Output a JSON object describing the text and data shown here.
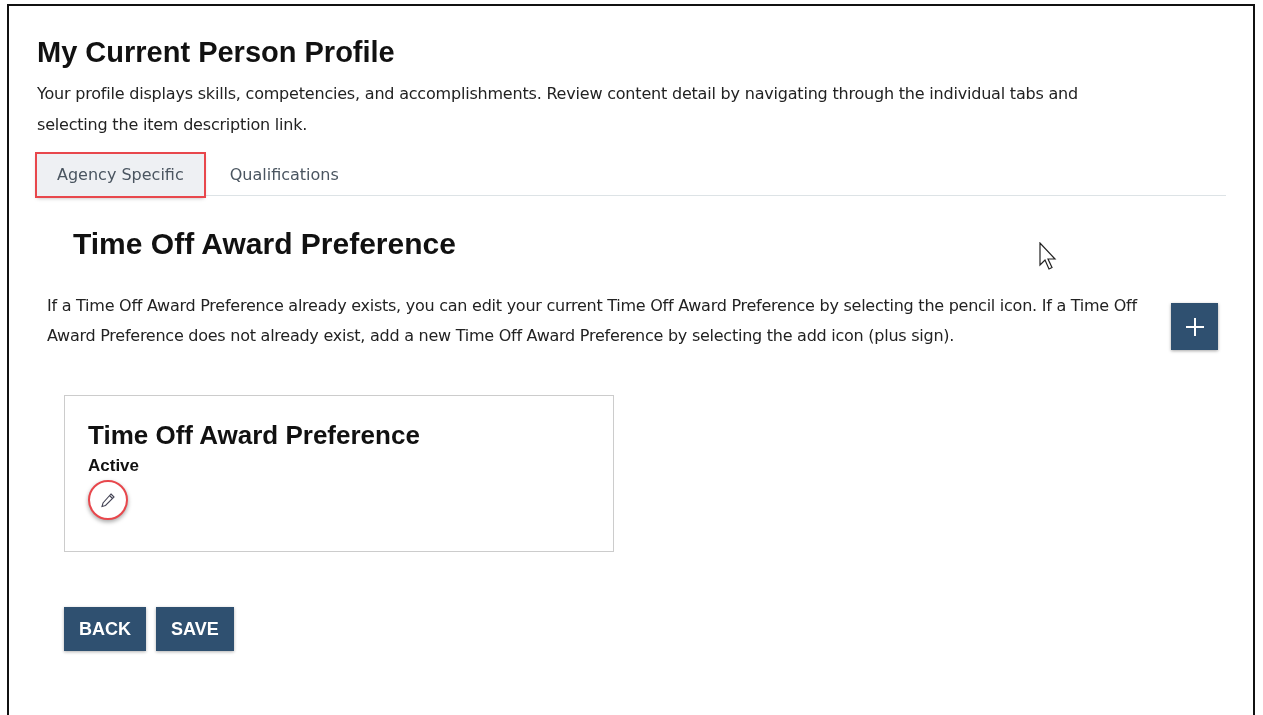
{
  "page": {
    "title": "My Current Person Profile",
    "description": "Your profile displays skills, competencies, and accomplishments. Review content detail by navigating through the individual tabs and selecting the item description link."
  },
  "tabs": [
    {
      "label": "Agency Specific",
      "selected": true,
      "highlighted": true
    },
    {
      "label": "Qualifications",
      "selected": false,
      "highlighted": false
    }
  ],
  "section": {
    "title": "Time Off Award Preference",
    "instructions": "If a Time Off Award Preference already exists, you can edit your current Time Off Award Preference by selecting the pencil icon. If a Time Off Award Preference does not already exist, add a new Time Off Award Preference by selecting the add icon (plus sign)."
  },
  "cards": [
    {
      "title": "Time Off Award Preference",
      "status": "Active",
      "edit_highlighted": true
    }
  ],
  "buttons": [
    "BACK",
    "SAVE"
  ]
}
